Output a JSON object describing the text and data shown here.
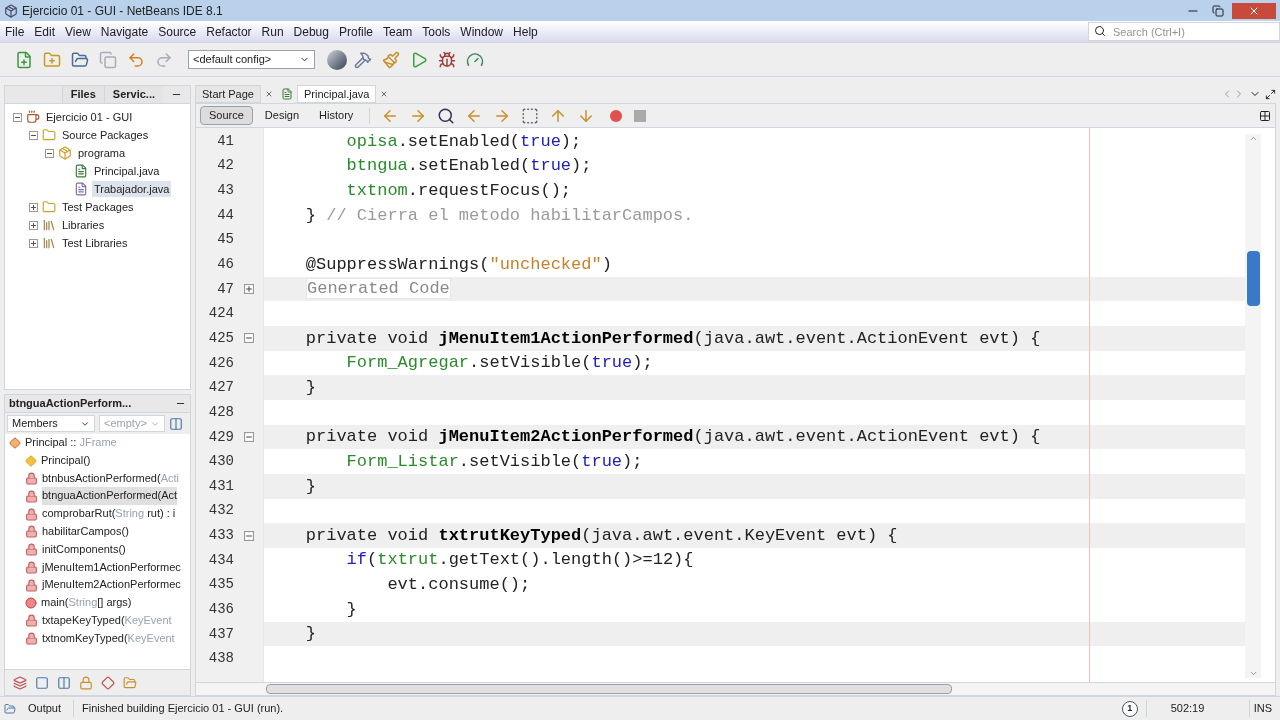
{
  "window": {
    "title": "Ejercicio 01 - GUI - NetBeans IDE 8.1"
  },
  "menu": [
    "File",
    "Edit",
    "View",
    "Navigate",
    "Source",
    "Refactor",
    "Run",
    "Debug",
    "Profile",
    "Team",
    "Tools",
    "Window",
    "Help"
  ],
  "search": {
    "placeholder": "Search (Ctrl+I)"
  },
  "toolbar": {
    "config": "<default config>"
  },
  "projects_panel": {
    "tabs": [
      {
        "label": "Files",
        "selected": false
      },
      {
        "label": "Servic...",
        "selected": false
      }
    ],
    "tree": [
      {
        "label": "Ejercicio 01 - GUI",
        "kind": "project",
        "expanded": true,
        "selected": false,
        "children": [
          {
            "label": "Source Packages",
            "kind": "folder",
            "expanded": true,
            "selected": false,
            "children": [
              {
                "label": "programa",
                "kind": "package",
                "expanded": true,
                "selected": false,
                "children": [
                  {
                    "label": "Principal.java",
                    "kind": "form",
                    "selected": false
                  },
                  {
                    "label": "Trabajador.java",
                    "kind": "java",
                    "selected": true
                  }
                ]
              }
            ]
          },
          {
            "label": "Test Packages",
            "kind": "folder",
            "expanded": false,
            "selected": false
          },
          {
            "label": "Libraries",
            "kind": "library",
            "expanded": false,
            "selected": false
          },
          {
            "label": "Test Libraries",
            "kind": "library",
            "expanded": false,
            "selected": false
          }
        ]
      }
    ]
  },
  "navigator": {
    "title": "btnguaActionPerform...",
    "filter": "Members",
    "scope": "<empty>",
    "root": [
      {
        "text": "Principal :: ",
        "muted": false
      },
      {
        "text": "JFrame",
        "muted": true
      }
    ],
    "items": [
      {
        "kind": "constructor",
        "selected": false,
        "parts": [
          {
            "text": "Principal()",
            "muted": false
          }
        ]
      },
      {
        "kind": "private",
        "selected": false,
        "parts": [
          {
            "text": "btnbusActionPerformed(",
            "muted": false
          },
          {
            "text": "Acti",
            "muted": true
          }
        ]
      },
      {
        "kind": "private",
        "selected": true,
        "parts": [
          {
            "text": "btnguaActionPerformed(Act",
            "muted": false
          }
        ]
      },
      {
        "kind": "private",
        "selected": false,
        "parts": [
          {
            "text": "comprobarRut(",
            "muted": false
          },
          {
            "text": "String",
            "muted": true
          },
          {
            "text": " rut) : i",
            "muted": false
          }
        ]
      },
      {
        "kind": "private",
        "selected": false,
        "parts": [
          {
            "text": "habilitarCampos()",
            "muted": false
          }
        ]
      },
      {
        "kind": "private",
        "selected": false,
        "parts": [
          {
            "text": "initComponents()",
            "muted": false
          }
        ]
      },
      {
        "kind": "private",
        "selected": false,
        "parts": [
          {
            "text": "jMenuItem1ActionPerformec",
            "muted": false
          }
        ]
      },
      {
        "kind": "private",
        "selected": false,
        "parts": [
          {
            "text": "jMenuItem2ActionPerformec",
            "muted": false
          }
        ]
      },
      {
        "kind": "static",
        "selected": false,
        "parts": [
          {
            "text": "main(",
            "muted": false
          },
          {
            "text": "String",
            "muted": true
          },
          {
            "text": "[] args)",
            "muted": false
          }
        ]
      },
      {
        "kind": "private",
        "selected": false,
        "parts": [
          {
            "text": "txtapeKeyTyped(",
            "muted": false
          },
          {
            "text": "KeyEvent",
            "muted": true
          }
        ]
      },
      {
        "kind": "private",
        "selected": false,
        "parts": [
          {
            "text": "txtnomKeyTyped(",
            "muted": false
          },
          {
            "text": "KeyEvent",
            "muted": true
          }
        ]
      }
    ]
  },
  "editor": {
    "tabs": [
      {
        "label": "Start Page",
        "selected": false
      },
      {
        "label": "Principal.java",
        "selected": true
      }
    ],
    "views": [
      {
        "label": "Source",
        "selected": true
      },
      {
        "label": "Design",
        "selected": false
      },
      {
        "label": "History",
        "selected": false
      }
    ],
    "lines": [
      {
        "number": "41",
        "highlighted": false,
        "tokens": [
          {
            "kind": "field",
            "text": "        opisa"
          },
          {
            "kind": "plain",
            "text": ".setEnabled("
          },
          {
            "kind": "keyword",
            "text": "true"
          },
          {
            "kind": "plain",
            "text": ");"
          }
        ]
      },
      {
        "number": "42",
        "highlighted": false,
        "tokens": [
          {
            "kind": "field",
            "text": "        btngua"
          },
          {
            "kind": "plain",
            "text": ".setEnabled("
          },
          {
            "kind": "keyword",
            "text": "true"
          },
          {
            "kind": "plain",
            "text": ");"
          }
        ]
      },
      {
        "number": "43",
        "highlighted": false,
        "tokens": [
          {
            "kind": "field",
            "text": "        txtnom"
          },
          {
            "kind": "plain",
            "text": ".requestFocus();"
          }
        ]
      },
      {
        "number": "44",
        "highlighted": false,
        "tokens": [
          {
            "kind": "plain",
            "text": "    } "
          },
          {
            "kind": "comment",
            "text": "// Cierra el metodo habilitarCampos."
          }
        ]
      },
      {
        "number": "45",
        "highlighted": false
      },
      {
        "number": "46",
        "highlighted": false,
        "tokens": [
          {
            "kind": "plain",
            "text": "    @SuppressWarnings("
          },
          {
            "kind": "string",
            "text": "\"unchecked\""
          },
          {
            "kind": "plain",
            "text": ")"
          }
        ]
      },
      {
        "number": "47",
        "collapsed": true,
        "highlighted": true,
        "tokens": [
          {
            "kind": "folded",
            "text": "Generated Code"
          }
        ]
      },
      {
        "number": "424",
        "highlighted": false
      },
      {
        "number": "425",
        "collapsed": false,
        "highlighted": true,
        "tokens": [
          {
            "kind": "plain",
            "text": "    private void "
          },
          {
            "kind": "method",
            "text": "jMenuItem1ActionPerformed"
          },
          {
            "kind": "plain",
            "text": "(java.awt.event.ActionEvent evt) {"
          }
        ]
      },
      {
        "number": "426",
        "highlighted": false,
        "tokens": [
          {
            "kind": "field",
            "text": "        Form_Agregar"
          },
          {
            "kind": "plain",
            "text": ".setVisible("
          },
          {
            "kind": "keyword",
            "text": "true"
          },
          {
            "kind": "plain",
            "text": ");"
          }
        ]
      },
      {
        "number": "427",
        "highlighted": true,
        "tokens": [
          {
            "kind": "plain",
            "text": "    }"
          }
        ]
      },
      {
        "number": "428",
        "highlighted": false
      },
      {
        "number": "429",
        "collapsed": false,
        "highlighted": true,
        "tokens": [
          {
            "kind": "plain",
            "text": "    private void "
          },
          {
            "kind": "method",
            "text": "jMenuItem2ActionPerformed"
          },
          {
            "kind": "plain",
            "text": "(java.awt.event.ActionEvent evt) {"
          }
        ]
      },
      {
        "number": "430",
        "highlighted": false,
        "tokens": [
          {
            "kind": "field",
            "text": "        Form_Listar"
          },
          {
            "kind": "plain",
            "text": ".setVisible("
          },
          {
            "kind": "keyword",
            "text": "true"
          },
          {
            "kind": "plain",
            "text": ");"
          }
        ]
      },
      {
        "number": "431",
        "highlighted": true,
        "tokens": [
          {
            "kind": "plain",
            "text": "    }"
          }
        ]
      },
      {
        "number": "432",
        "highlighted": false
      },
      {
        "number": "433",
        "collapsed": false,
        "highlighted": true,
        "tokens": [
          {
            "kind": "plain",
            "text": "    private void "
          },
          {
            "kind": "method",
            "text": "txtrutKeyTyped"
          },
          {
            "kind": "plain",
            "text": "(java.awt.event.KeyEvent evt) {"
          }
        ]
      },
      {
        "number": "434",
        "highlighted": false,
        "tokens": [
          {
            "kind": "keyword",
            "text": "        if"
          },
          {
            "kind": "plain",
            "text": "("
          },
          {
            "kind": "field",
            "text": "txtrut"
          },
          {
            "kind": "plain",
            "text": ".getText().length()>=12){"
          }
        ]
      },
      {
        "number": "435",
        "highlighted": false,
        "tokens": [
          {
            "kind": "plain",
            "text": "            evt.consume();"
          }
        ]
      },
      {
        "number": "436",
        "highlighted": false,
        "tokens": [
          {
            "kind": "plain",
            "text": "        }"
          }
        ]
      },
      {
        "number": "437",
        "highlighted": true,
        "tokens": [
          {
            "kind": "plain",
            "text": "    }"
          }
        ]
      },
      {
        "number": "438",
        "highlighted": false
      }
    ]
  },
  "status_bar": {
    "output": "Output",
    "message": "Finished building Ejercicio 01 - GUI (run).",
    "notifications": "1",
    "position": "502:19",
    "mode": "INS"
  }
}
